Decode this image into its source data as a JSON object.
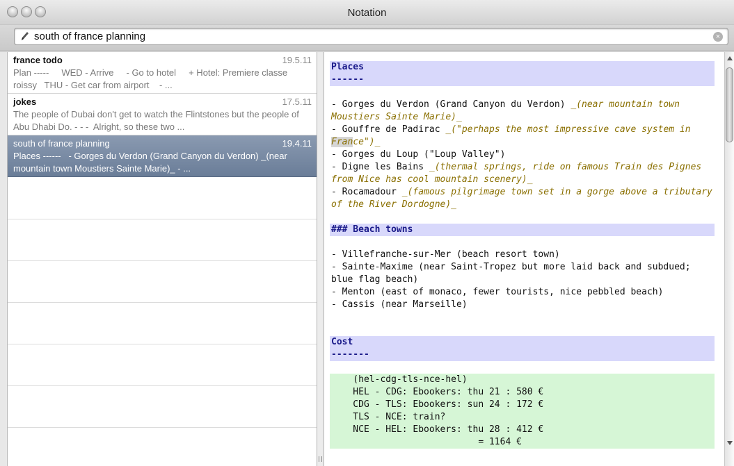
{
  "window": {
    "title": "Notation"
  },
  "search": {
    "value": "south of france planning"
  },
  "notes": [
    {
      "title": "france todo",
      "date": "19.5.11",
      "preview": "Plan -----     WED - Arrive     - Go to hotel     + Hotel: Premiere classe roissy   THU - Get car from airport    - ..."
    },
    {
      "title": "jokes",
      "date": "17.5.11",
      "preview": "The people of Dubai don't get to watch the Flintstones but the people of Abu Dhabi Do. - - -  Alright, so these two ..."
    },
    {
      "title": "south of france planning",
      "date": "19.4.11",
      "preview": "Places ------   - Gorges du Verdon (Grand Canyon du Verdon) _(near mountain town Moustiers Sainte Marie)_ - ..."
    }
  ],
  "editor": {
    "places_header": "Places",
    "places_rule": "------",
    "places": [
      {
        "text": "- Gorges du Verdon (Grand Canyon du Verdon) ",
        "note": "_(near mountain town Moustiers Sainte Marie)_"
      },
      {
        "text": "- Gouffre de Padirac ",
        "note_a": "_(\"perhaps the most impressive cave system in ",
        "note_hl": "Fran",
        "note_b": "ce\")_"
      },
      {
        "text": "- Gorges du Loup (\"Loup Valley\")"
      },
      {
        "text": "- Digne les Bains ",
        "note": "_(thermal springs, ride on famous Train des Pignes from Nice has cool mountain scenery)_"
      },
      {
        "text": "- Rocamadour ",
        "note": "_(famous pilgrimage town set in a gorge above a tributary of the River Dordogne)_"
      }
    ],
    "beach_header": "### Beach towns",
    "beach": [
      "- Villefranche-sur-Mer (beach resort town)",
      "- Sainte-Maxime (near Saint-Tropez but more laid back and subdued; blue flag beach)",
      "- Menton (east of monaco, fewer tourists, nice pebbled beach)",
      "- Cassis (near Marseille)"
    ],
    "cost_header": "Cost",
    "cost_rule": "-------",
    "cost_code": [
      "    (hel-cdg-tls-nce-hel)",
      "    HEL - CDG: Ebookers: thu 21 : 580 €",
      "    CDG - TLS: Ebookers: sun 24 : 172 €",
      "    TLS - NCE: train?",
      "    NCE - HEL: Ebookers: thu 28 : 412 €",
      "                           = 1164 €"
    ]
  }
}
